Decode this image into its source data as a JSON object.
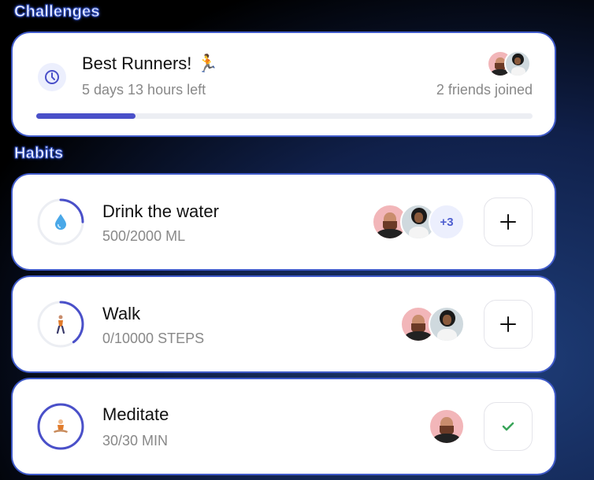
{
  "sections": {
    "challenges": "Challenges",
    "habits": "Habits"
  },
  "challenge": {
    "title": "Best Runners! 🏃",
    "time_left": "5 days 13 hours left",
    "friends": "2 friends joined",
    "progress": 0.2,
    "icon": "clock-icon"
  },
  "habits": [
    {
      "title": "Drink the water",
      "sub": "500/2000 ML",
      "progress": 0.25,
      "icon": "water-drop-icon",
      "extra_count": "+3",
      "action": "plus-icon"
    },
    {
      "title": "Walk",
      "sub": "0/10000 STEPS",
      "progress": 0.4,
      "icon": "walking-person-icon",
      "action": "plus-icon"
    },
    {
      "title": "Meditate",
      "sub": "30/30 MIN",
      "progress": 1.0,
      "icon": "meditation-icon",
      "action": "check-icon"
    }
  ],
  "colors": {
    "accent": "#4a50c9",
    "track": "#eceef3",
    "check": "#3aa55a",
    "border": "#3f5ac9"
  }
}
